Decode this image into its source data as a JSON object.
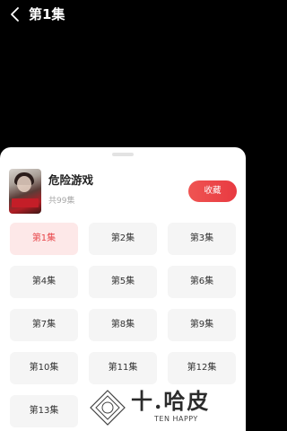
{
  "header": {
    "title": "第1集"
  },
  "drama": {
    "name": "危险游戏",
    "episode_total": "共99集",
    "collect_label": "收藏"
  },
  "episodes": [
    "第1集",
    "第2集",
    "第3集",
    "第4集",
    "第5集",
    "第6集",
    "第7集",
    "第8集",
    "第9集",
    "第10集",
    "第11集",
    "第12集",
    "第13集"
  ],
  "active_episode": "第1集",
  "watermark": {
    "text": "十.哈皮",
    "sub": "TEN HAPPY"
  },
  "colors": {
    "accent": "#e8464a",
    "active_bg": "#fde8e8",
    "chip_bg": "#f5f5f5"
  }
}
